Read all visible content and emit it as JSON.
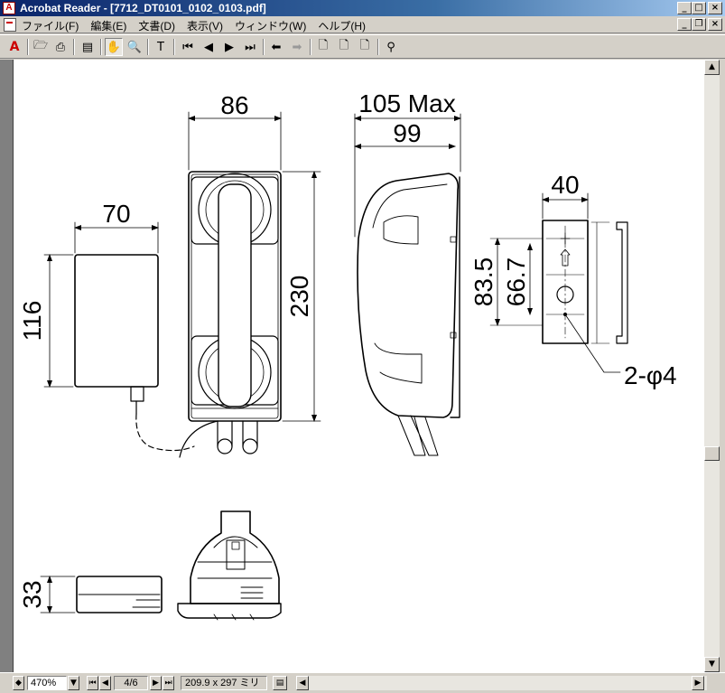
{
  "window": {
    "title": "Acrobat Reader - [7712_DT0101_0102_0103.pdf]",
    "app_icon": "acrobat-icon",
    "controls": [
      "minimize-icon",
      "maximize-icon",
      "close-icon"
    ],
    "doc_controls": [
      "minimize-icon",
      "restore-icon",
      "close-icon"
    ]
  },
  "menu": {
    "items": [
      "ファイル(F)",
      "編集(E)",
      "文書(D)",
      "表示(V)",
      "ウィンドウ(W)",
      "ヘルプ(H)"
    ]
  },
  "toolbar": {
    "icons": [
      "adobe-logo-icon",
      "open-icon",
      "print-icon",
      "show-hide-navigation-icon",
      "hand-tool-icon",
      "zoom-tool-icon",
      "text-select-icon",
      "first-page-icon",
      "previous-page-icon",
      "next-page-icon",
      "last-page-icon",
      "go-back-icon",
      "go-forward-icon",
      "actual-size-icon",
      "fit-page-icon",
      "fit-width-icon",
      "find-icon"
    ]
  },
  "drawing": {
    "dims": {
      "adapter_width": "70",
      "adapter_height": "116",
      "phone_width": "86",
      "phone_height": "230",
      "side_max": "105 Max",
      "side_depth": "99",
      "bracket_width": "40",
      "bracket_h1": "83.5",
      "bracket_h2": "66.7",
      "hole_note": "2-φ4",
      "adapter_thickness": "33"
    }
  },
  "status": {
    "zoom": "470%",
    "page": "4/6",
    "page_size": "209.9 x 297 ミリ"
  },
  "colors": {
    "title_start": "#0a246a",
    "title_end": "#a6caf0",
    "chrome": "#d4d0c8"
  }
}
